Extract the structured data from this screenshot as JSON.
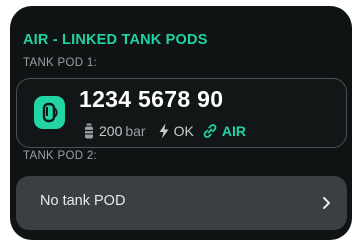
{
  "panel": {
    "title": "AIR - LINKED TANK PODS",
    "pod1": {
      "label": "TANK POD 1:",
      "id": "1234 5678 90",
      "pressure_value": "200",
      "pressure_unit": "bar",
      "status": "OK",
      "link_gas": "AIR",
      "icon": "tank-pod-icon"
    },
    "pod2": {
      "label": "TANK POD 2:",
      "text": "No tank POD",
      "icon": "chevron-right-icon"
    }
  },
  "colors": {
    "accent": "#21d3a4",
    "panel_bg": "#101314",
    "row_bg": "#3b3f42"
  }
}
